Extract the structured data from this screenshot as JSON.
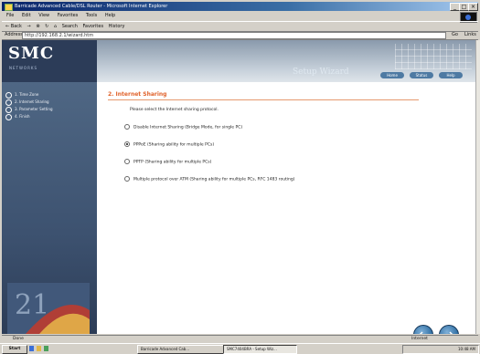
{
  "window": {
    "title": "Barricade Advanced Cable/DSL Router - Microsoft Internet Explorer",
    "buttons": {
      "minimize": "_",
      "maximize": "□",
      "close": "×"
    }
  },
  "menu": [
    "File",
    "Edit",
    "View",
    "Favorites",
    "Tools",
    "Help"
  ],
  "toolbar": {
    "back": "← Back",
    "forward": "→",
    "stop": "⊗",
    "refresh": "↻",
    "home": "⌂",
    "search": "Search",
    "favorites": "Favorites",
    "history": "History"
  },
  "address": {
    "label": "Address",
    "value": "http://192.168.2.1/wizard.htm",
    "go": "Go",
    "links": "Links"
  },
  "header": {
    "logo": "SMC",
    "logo_sub": "NETWORKS",
    "wizard_title": "Setup Wizard",
    "nav": [
      "Home",
      "Status",
      "Help"
    ]
  },
  "sidebar": {
    "items": [
      "1. Time Zone",
      "2. Internet Sharing",
      "3. Parameter Setting",
      "4. Finish"
    ]
  },
  "main": {
    "title": "2. Internet Sharing",
    "prompt": "Please select the Internet sharing protocol.",
    "options": [
      {
        "label": "Disable Internet Sharing (Bridge Mode, for single PC)",
        "selected": false
      },
      {
        "label": "PPPoE (Sharing ability for multiple PCs)",
        "selected": true
      },
      {
        "label": "PPTP (Sharing ability for multiple PCs)",
        "selected": false
      },
      {
        "label": "Multiple protocol over ATM (Sharing ability for multiple PCs, RFC 1483 routing)",
        "selected": false
      }
    ]
  },
  "status": {
    "text": "Done",
    "zone": "Internet"
  },
  "taskbar": {
    "start": "Start",
    "items": [
      "Barricade Advanced Cab...",
      "SMC7404BRA - Setup Wiz..."
    ],
    "clock": "10:48 AM"
  },
  "colors": {
    "accent": "#e0622a",
    "sidebar": "#3d5270",
    "header": "#2c3c58",
    "button": "#2a6aa0"
  },
  "icons": [
    "window-icon",
    "ie-logo-icon",
    "back-nav-icon",
    "next-nav-icon"
  ]
}
